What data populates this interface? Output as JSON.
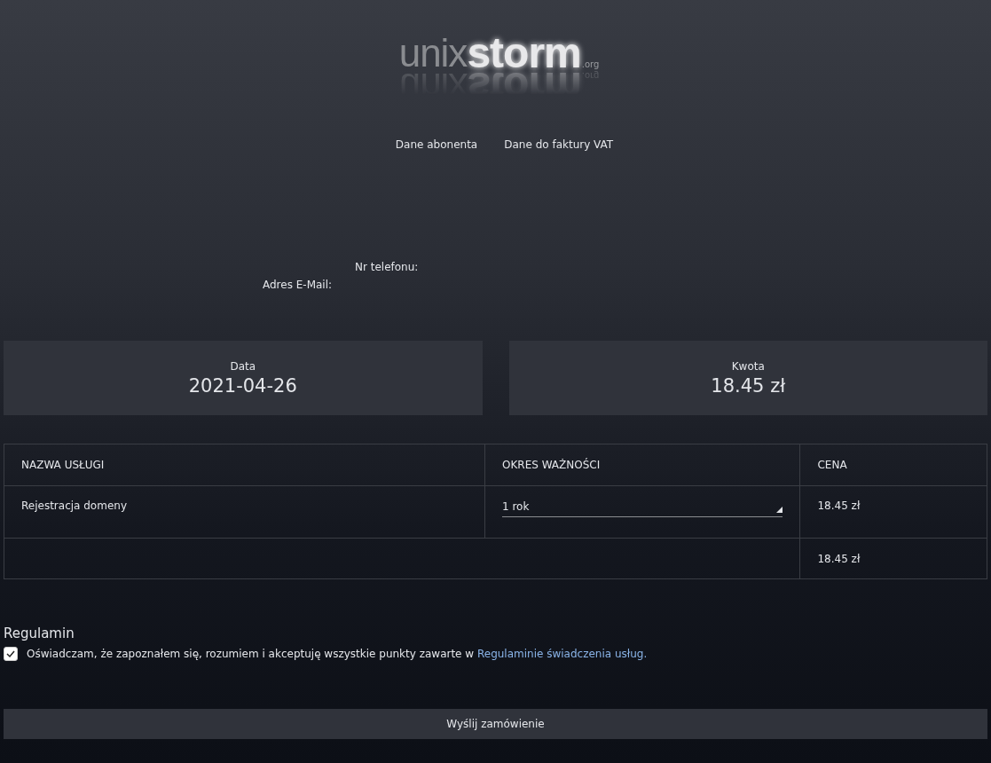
{
  "logo": {
    "part_1": "unix",
    "part_2": "storm",
    "suffix": ".org"
  },
  "tabs": [
    {
      "label": "Dane abonenta"
    },
    {
      "label": "Dane do faktury VAT"
    }
  ],
  "fields": [
    {
      "label": "Nr telefonu:"
    },
    {
      "label": "Adres E-Mail:"
    }
  ],
  "summary": [
    {
      "label": "Data",
      "value": "2021-04-26"
    },
    {
      "label": "Kwota",
      "value": "18.45 zł"
    }
  ],
  "table": {
    "columns": [
      "NAZWA USŁUGI",
      "OKRES WAŻNOŚCI",
      "CENA"
    ],
    "rows": [
      {
        "service": "Rejestracja domeny",
        "period": "1 rok",
        "price": "18.45 zł"
      }
    ],
    "total": "18.45 zł"
  },
  "terms": {
    "heading": "Regulamin",
    "checked": true,
    "text": "Oświadczam, że zapoznałem się, rozumiem i akceptuję wszystkie punkty zawarte w ",
    "link": "Regulaminie świadczenia usług."
  },
  "submit": "Wyślij zamówienie"
}
